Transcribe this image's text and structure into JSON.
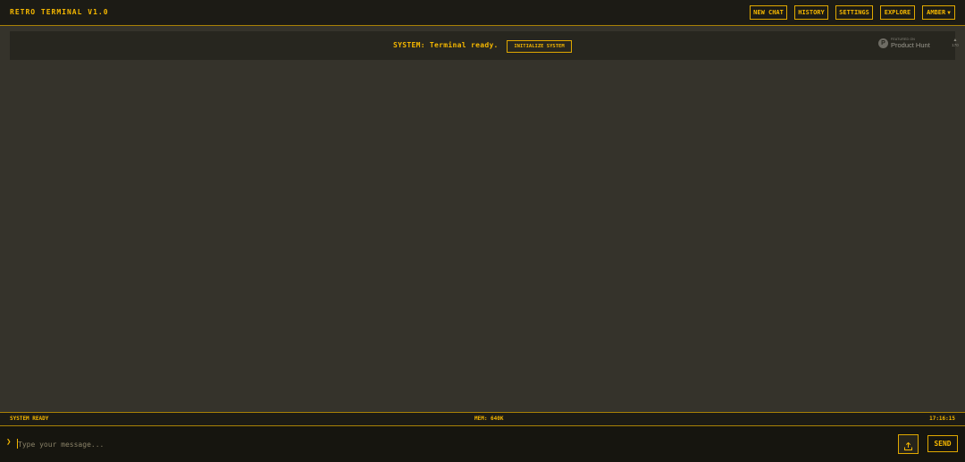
{
  "header": {
    "title": "RETRO TERMINAL V1.0",
    "nav": {
      "new_chat": "NEW CHAT",
      "history": "HISTORY",
      "settings": "SETTINGS",
      "explore": "EXPLORE",
      "theme": "AMBER"
    }
  },
  "main": {
    "system_message": "SYSTEM: Terminal ready.",
    "initialize_label": "INITIALIZE SYSTEM",
    "product_hunt": {
      "featured": "FEATURED ON",
      "name": "Product Hunt",
      "count": "170"
    }
  },
  "status_bar": {
    "left": "SYSTEM READY",
    "center": "MEM: 640K",
    "right": "17:16:15"
  },
  "input": {
    "prompt_symbol": "❯",
    "placeholder": "Type your message...",
    "value": "",
    "send_label": "SEND"
  },
  "colors": {
    "accent": "#f5b700",
    "background": "#35332b",
    "panel": "#27261f"
  },
  "icons": {
    "upload": "upload-icon",
    "prompt": "prompt-chevron-icon",
    "theme_dropdown": "chevron-down-icon"
  }
}
